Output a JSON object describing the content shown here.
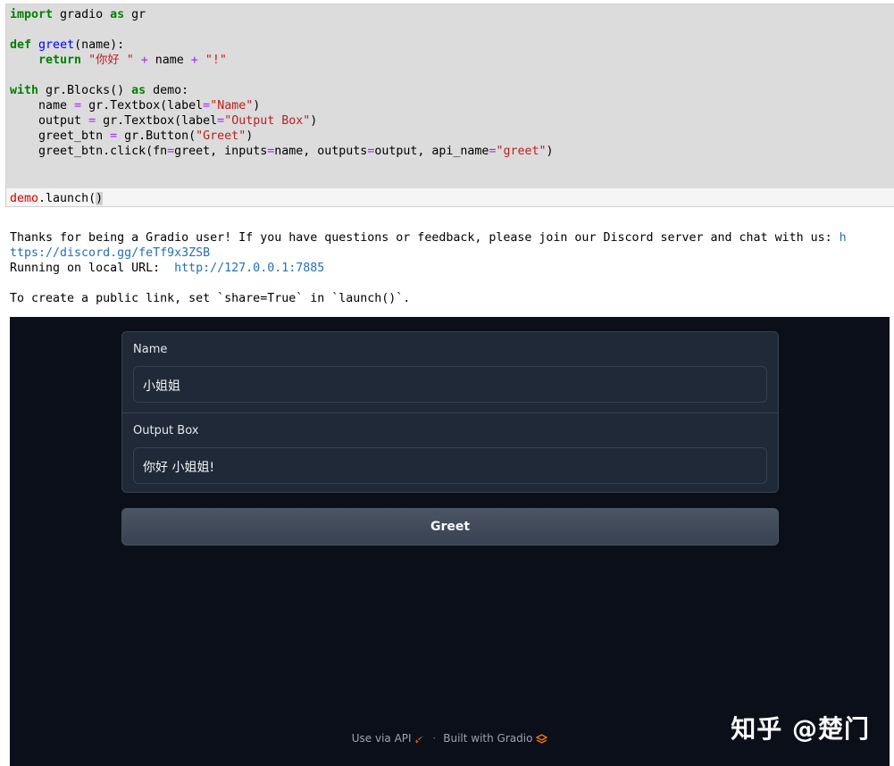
{
  "code": {
    "line_import": [
      "import",
      " gradio ",
      "as",
      " gr"
    ],
    "line_def": [
      "def",
      " ",
      "greet",
      "(name):"
    ],
    "line_return": [
      "    ",
      "return",
      " ",
      "\"你好 \"",
      " ",
      "+",
      " name ",
      "+",
      " ",
      "\"!\""
    ],
    "line_with": [
      "with",
      " gr.Blocks() ",
      "as",
      " demo:"
    ],
    "line_name": [
      "    name ",
      "=",
      " gr.Textbox(label",
      "=",
      "\"Name\"",
      ")"
    ],
    "line_output": [
      "    output ",
      "=",
      " gr.Textbox(label",
      "=",
      "\"Output Box\"",
      ")"
    ],
    "line_btn": [
      "    greet_btn ",
      "=",
      " gr.Button(",
      "\"Greet\"",
      ")"
    ],
    "line_click": [
      "    greet_btn.click(fn",
      "=",
      "greet, inputs",
      "=",
      "name, outputs",
      "=",
      "output, api_name",
      "=",
      "\"greet\"",
      ")"
    ],
    "line_launch": [
      "demo",
      ".launch(",
      ")"
    ]
  },
  "output": {
    "line1_text": "Thanks for being a Gradio user! If you have questions or feedback, please join our Discord server and chat with us: ",
    "line1_link_start": "h",
    "line2_link": "ttps://discord.gg/feTf9x3ZSB",
    "line3_text": "Running on local URL:  ",
    "line3_link": "http://127.0.0.1:7885",
    "line5_text": "To create a public link, set `share=True` in `launch()`."
  },
  "app": {
    "name_label": "Name",
    "name_value": "小姐姐",
    "output_label": "Output Box",
    "output_value": "你好 小姐姐!",
    "button_label": "Greet",
    "footer_api": "Use via API",
    "footer_sep": "·",
    "footer_built": "Built with Gradio"
  },
  "watermark": "知乎 @楚门",
  "colors": {
    "app_bg": "#0b0f19",
    "panel_bg": "#1f2937",
    "accent_orange": "#f97316"
  }
}
